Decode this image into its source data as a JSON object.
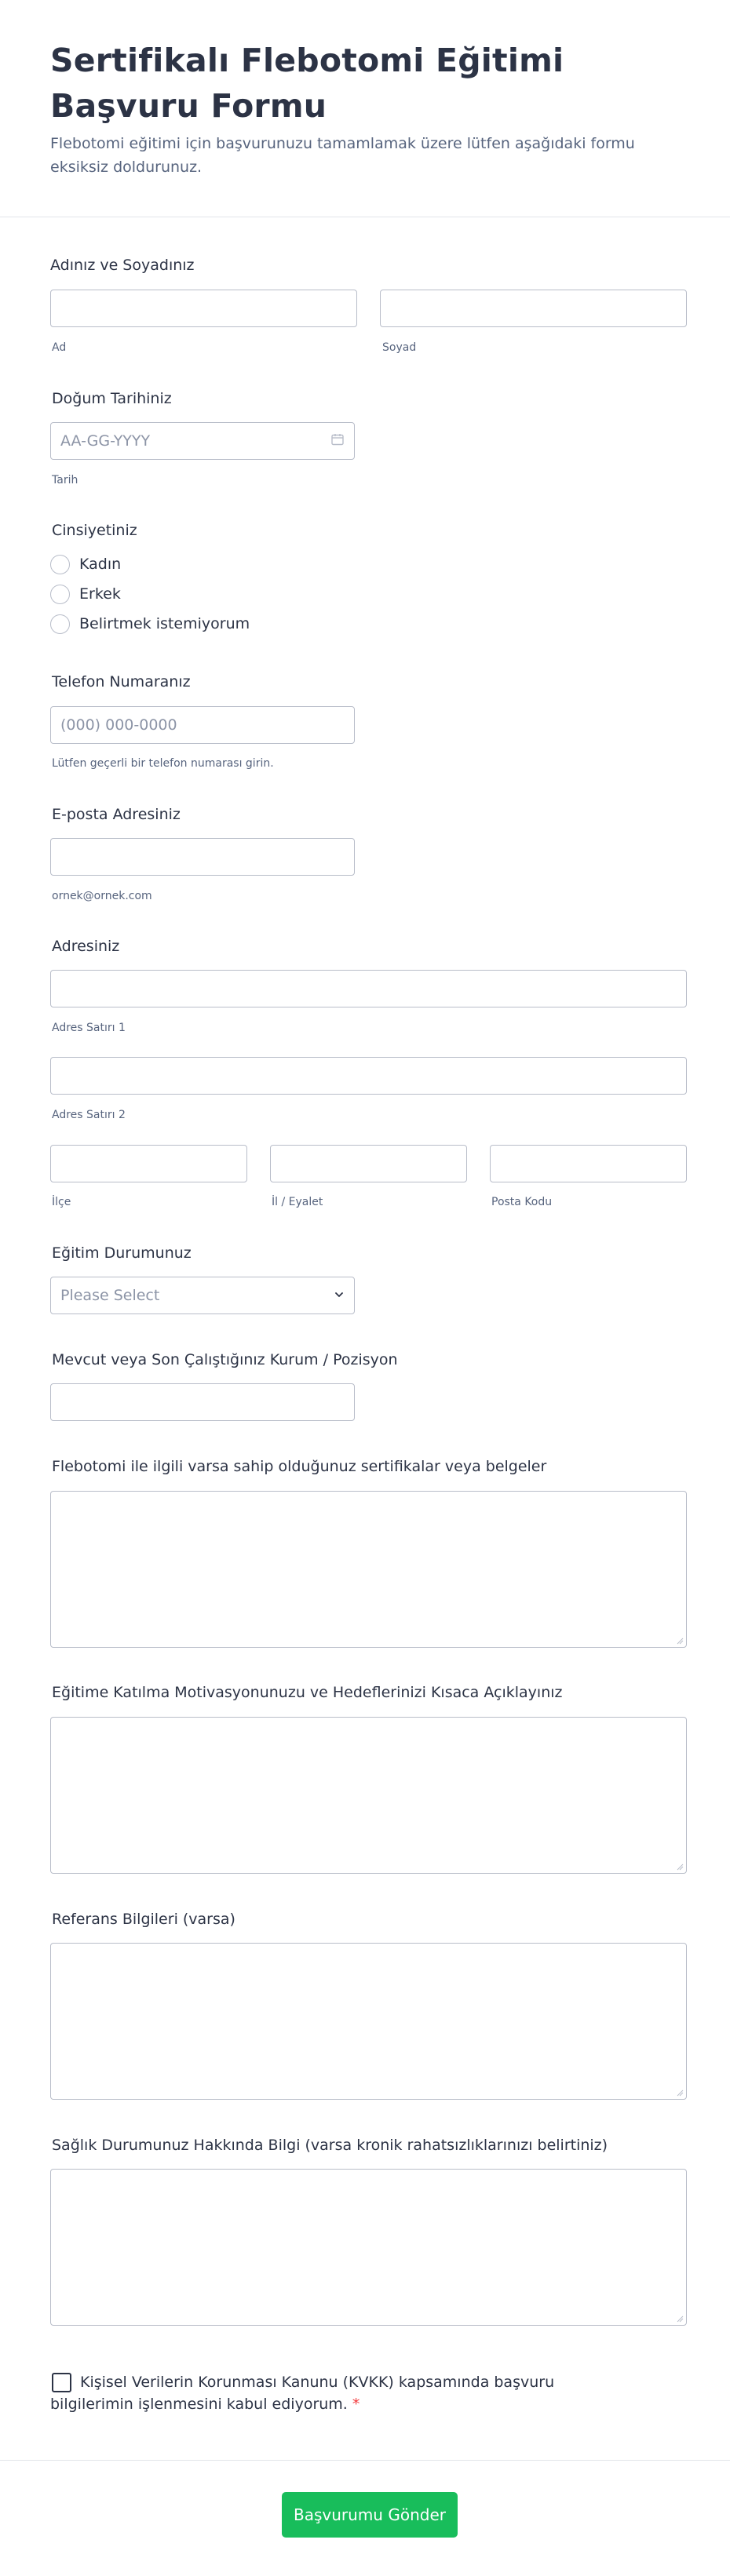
{
  "form": {
    "title": "Sertifikalı Flebotomi Eğitimi Başvuru Formu",
    "subtitle": "Flebotomi eğitimi için başvurunuzu tamamlamak üzere lütfen aşağıdaki formu eksiksiz doldurunuz."
  },
  "name": {
    "label": "Adınız ve Soyadınız",
    "first_sublabel": "Ad",
    "last_sublabel": "Soyad",
    "first_value": "",
    "last_value": ""
  },
  "birth": {
    "label": "Doğum Tarihiniz",
    "placeholder": "AA-GG-YYYY",
    "sublabel": "Tarih",
    "icon": "calendar-icon"
  },
  "gender": {
    "label": "Cinsiyetiniz",
    "options": [
      "Kadın",
      "Erkek",
      "Belirtmek istemiyorum"
    ]
  },
  "phone": {
    "label": "Telefon Numaranız",
    "placeholder": "(000) 000-0000",
    "sublabel": "Lütfen geçerli bir telefon numarası girin."
  },
  "email": {
    "label": "E-posta Adresiniz",
    "sublabel": "ornek@ornek.com",
    "value": ""
  },
  "address": {
    "label": "Adresiniz",
    "line1_sublabel": "Adres Satırı 1",
    "line2_sublabel": "Adres Satırı 2",
    "district_sublabel": "İlçe",
    "province_sublabel": "İl / Eyalet",
    "postal_sublabel": "Posta Kodu"
  },
  "education": {
    "label": "Eğitim Durumunuz",
    "placeholder": "Please Select",
    "icon": "chevron-down-icon"
  },
  "workplace": {
    "label": "Mevcut veya Son Çalıştığınız Kurum / Pozisyon",
    "value": ""
  },
  "certificates": {
    "label": "Flebotomi ile ilgili varsa sahip olduğunuz sertifikalar veya belgeler"
  },
  "motivation": {
    "label": "Eğitime Katılma Motivasyonunuzu ve Hedeflerinizi Kısaca Açıklayınız"
  },
  "references": {
    "label": "Referans Bilgileri (varsa)"
  },
  "health": {
    "label": "Sağlık Durumunuz Hakkında Bilgi (varsa kronik rahatsızlıklarınızı belirtiniz)"
  },
  "consent": {
    "line1": "Kişisel Verilerin Korunması Kanunu (KVKK) kapsamında başvuru",
    "line2": "bilgilerimin işlenmesini kabul ediyorum.",
    "required_mark": "*"
  },
  "submit": {
    "label": "Başvurumu Gönder"
  },
  "colors": {
    "accent": "#18bd5b",
    "text": "#2c3345",
    "muted": "#57647e",
    "border": "#b8bdc9",
    "required": "#f23a3c"
  }
}
